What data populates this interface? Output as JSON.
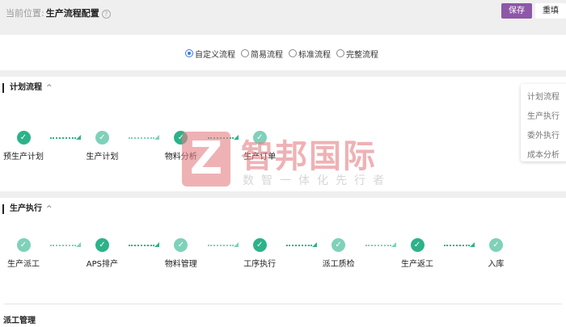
{
  "header": {
    "location_label": "当前位置:",
    "page_title": "生产流程配置",
    "help_icon": "?",
    "save_label": "保存",
    "reset_label": "重填"
  },
  "flow_types": [
    {
      "label": "自定义流程",
      "selected": true
    },
    {
      "label": "简易流程",
      "selected": false
    },
    {
      "label": "标准流程",
      "selected": false
    },
    {
      "label": "完整流程",
      "selected": false
    }
  ],
  "sections": [
    {
      "title": "计划流程",
      "steps": [
        {
          "label": "预生产计划",
          "state": "dark"
        },
        {
          "label": "生产计划",
          "state": "light"
        },
        {
          "label": "物料分析",
          "state": "dark"
        },
        {
          "label": "生产订单",
          "state": "light"
        }
      ]
    },
    {
      "title": "生产执行",
      "steps": [
        {
          "label": "生产派工",
          "state": "light"
        },
        {
          "label": "APS排产",
          "state": "dark"
        },
        {
          "label": "物料管理",
          "state": "light"
        },
        {
          "label": "工序执行",
          "state": "dark"
        },
        {
          "label": "派工质检",
          "state": "light"
        },
        {
          "label": "生产返工",
          "state": "dark"
        },
        {
          "label": "入库",
          "state": "light"
        }
      ]
    }
  ],
  "sub_section": "派工管理",
  "float_nav": [
    "计划流程",
    "生产执行",
    "委外执行",
    "成本分析"
  ],
  "watermark": {
    "logo": "Z",
    "name": "智邦国际",
    "slogan": "数智一体化先行者"
  },
  "colors": {
    "accent": "#8e57a8",
    "step_dark": "#2db28a",
    "step_light": "#7fd1b9",
    "radio": "#3b78e7"
  }
}
